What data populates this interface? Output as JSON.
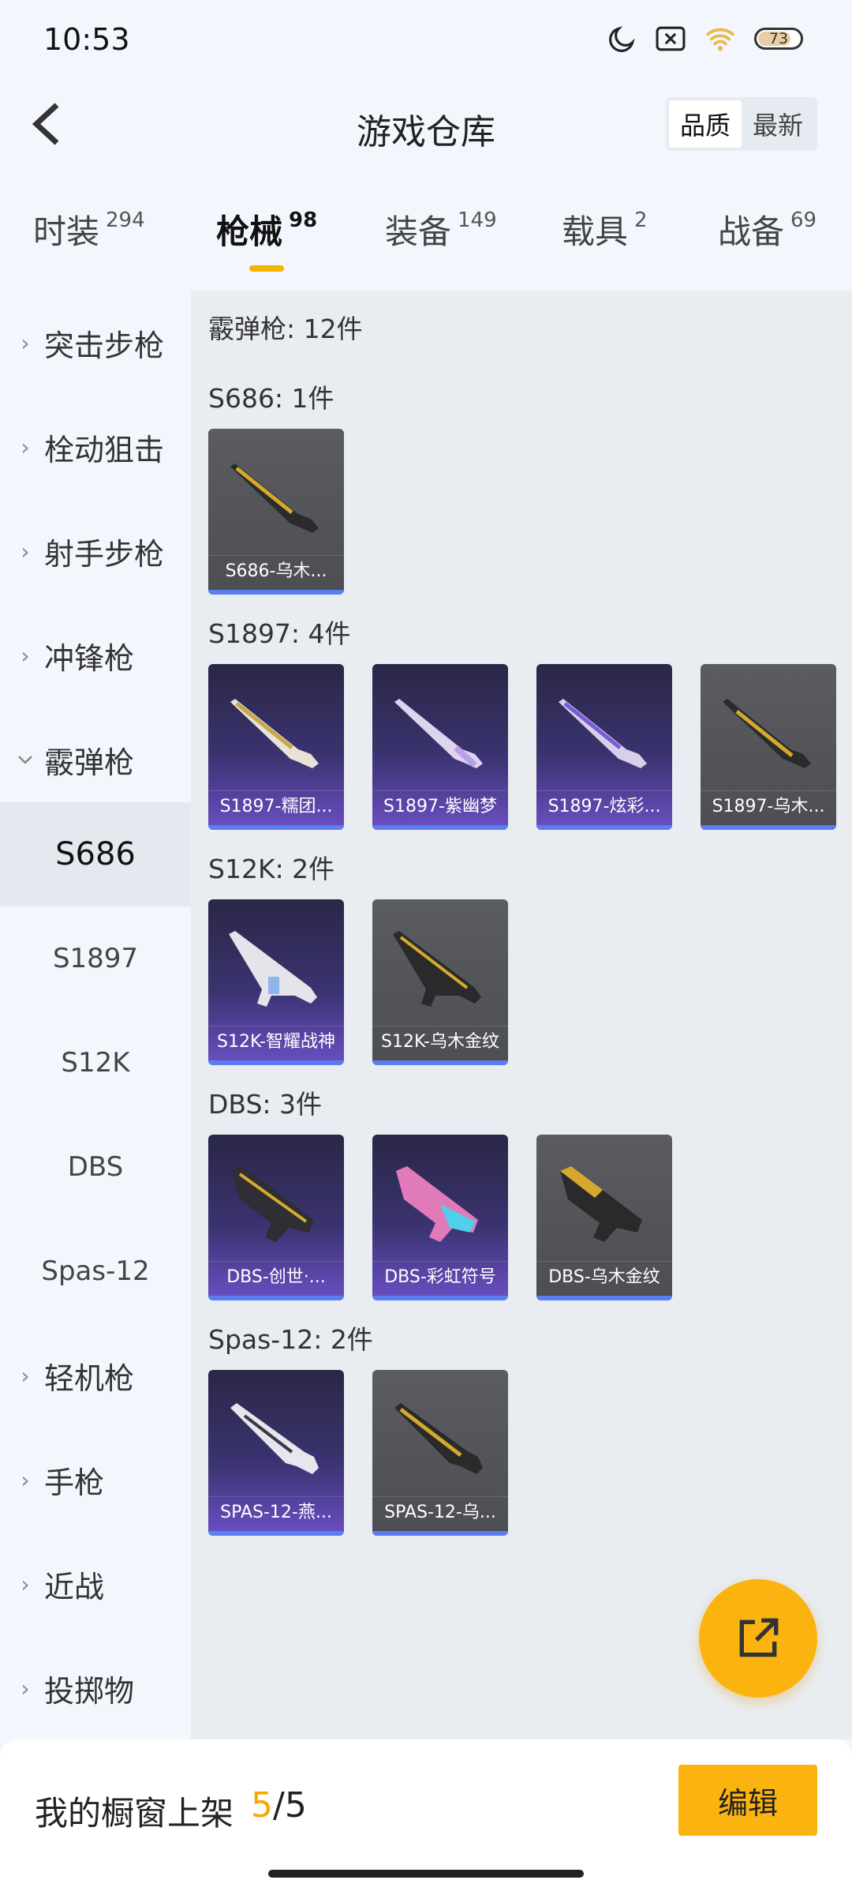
{
  "status": {
    "time": "10:53",
    "battery": "73"
  },
  "header": {
    "title": "游戏仓库",
    "sort_quality": "品质",
    "sort_newest": "最新"
  },
  "tabs": [
    {
      "label": "时装",
      "count": "294"
    },
    {
      "label": "枪械",
      "count": "98"
    },
    {
      "label": "装备",
      "count": "149"
    },
    {
      "label": "载具",
      "count": "2"
    },
    {
      "label": "战备",
      "count": "69"
    }
  ],
  "sidebar": {
    "groups": [
      "突击步枪",
      "栓动狙击",
      "射手步枪",
      "冲锋枪",
      "霰弹枪",
      "轻机枪",
      "手枪",
      "近战",
      "投掷物"
    ],
    "subs": [
      "S686",
      "S1897",
      "S12K",
      "DBS",
      "Spas-12"
    ]
  },
  "content": {
    "total": "霰弹枪: 12件",
    "sections": [
      {
        "title": "S686: 1件",
        "items": [
          {
            "name": "S686-乌木...",
            "rarity": "gray"
          }
        ]
      },
      {
        "title": "S1897: 4件",
        "items": [
          {
            "name": "S1897-糯团...",
            "rarity": "purple"
          },
          {
            "name": "S1897-紫幽梦",
            "rarity": "purple"
          },
          {
            "name": "S1897-炫彩...",
            "rarity": "purple"
          },
          {
            "name": "S1897-乌木...",
            "rarity": "gray"
          }
        ]
      },
      {
        "title": "S12K: 2件",
        "items": [
          {
            "name": "S12K-智耀战神",
            "rarity": "purple"
          },
          {
            "name": "S12K-乌木金纹",
            "rarity": "gray"
          }
        ]
      },
      {
        "title": "DBS: 3件",
        "items": [
          {
            "name": "DBS-创世·...",
            "rarity": "purple"
          },
          {
            "name": "DBS-彩虹符号",
            "rarity": "purple"
          },
          {
            "name": "DBS-乌木金纹",
            "rarity": "gray"
          }
        ]
      },
      {
        "title": "Spas-12: 2件",
        "items": [
          {
            "name": "SPAS-12-燕...",
            "rarity": "purple"
          },
          {
            "name": "SPAS-12-乌...",
            "rarity": "gray"
          }
        ]
      }
    ]
  },
  "bottom": {
    "label": "我的橱窗上架",
    "current": "5",
    "total": "/5",
    "edit": "编辑"
  },
  "colors": {
    "accent": "#fbb40f",
    "purple_card": "#4a3f8f",
    "gray_card": "#55575d",
    "rarity_bar": "#5a7df0"
  }
}
